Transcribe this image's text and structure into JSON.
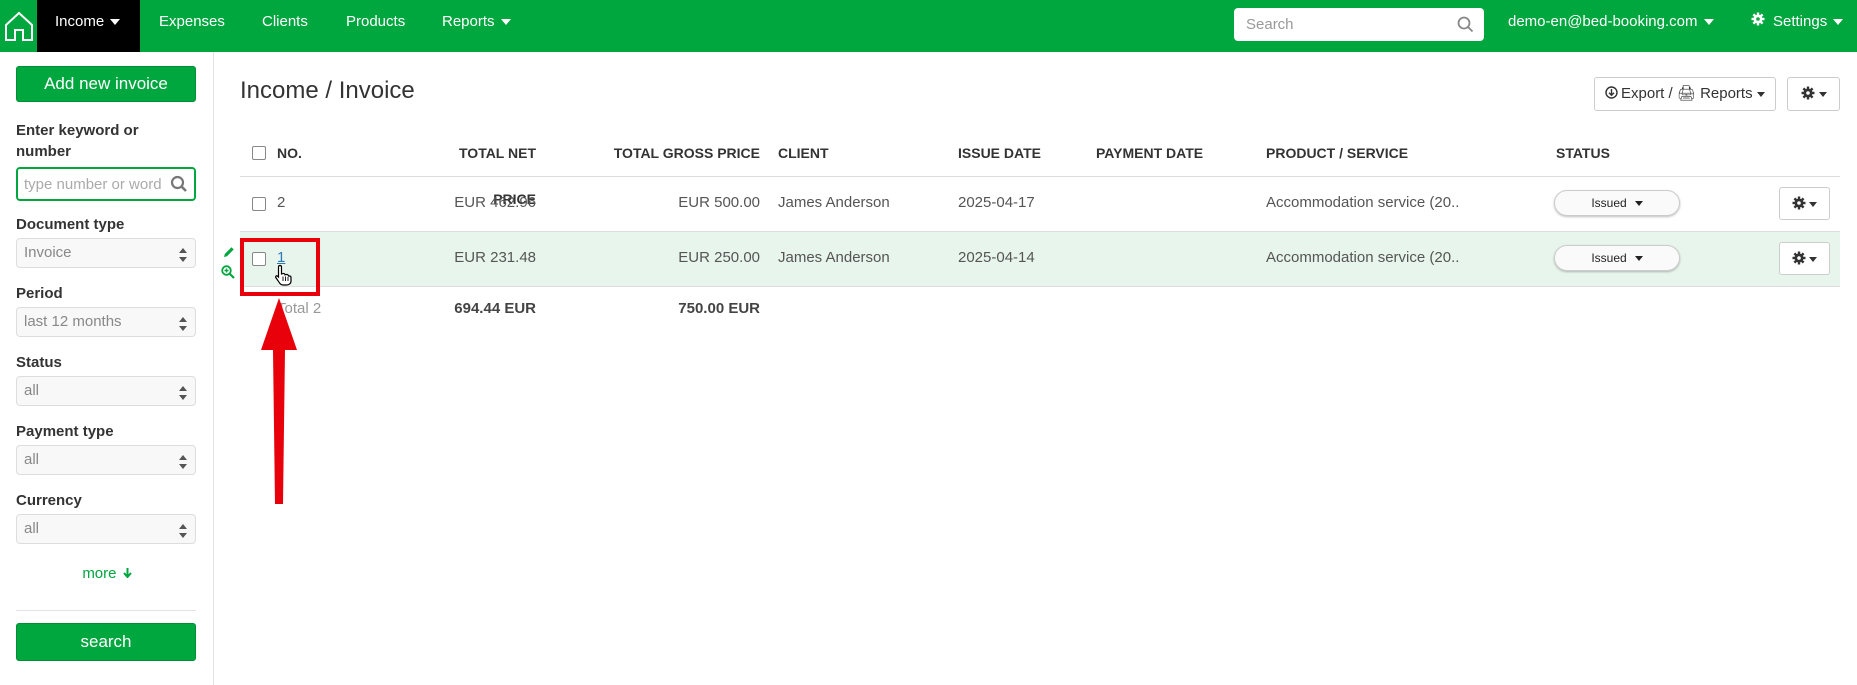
{
  "nav": {
    "items": [
      "Income",
      "Expenses",
      "Clients",
      "Products",
      "Reports"
    ],
    "search_placeholder": "Search",
    "user_email": "demo-en@bed-booking.com",
    "settings_label": "Settings"
  },
  "sidebar": {
    "add_button": "Add new invoice",
    "keyword_label": "Enter keyword or number",
    "keyword_placeholder": "type number or word",
    "document_type_label": "Document type",
    "document_type_value": "Invoice",
    "period_label": "Period",
    "period_value": "last 12 months",
    "status_label": "Status",
    "status_value": "all",
    "payment_type_label": "Payment type",
    "payment_type_value": "all",
    "currency_label": "Currency",
    "currency_value": "all",
    "more_link": "more",
    "search_button": "search"
  },
  "main": {
    "title": "Income / Invoice",
    "export_button": "Export / 🖨 Reports"
  },
  "table": {
    "headers": [
      "NO.",
      "TOTAL NET PRICE",
      "TOTAL GROSS PRICE",
      "CLIENT",
      "ISSUE DATE",
      "PAYMENT DATE",
      "PRODUCT / SERVICE",
      "STATUS"
    ],
    "rows": [
      {
        "no": "2",
        "net": "EUR 462.96",
        "gross": "EUR 500.00",
        "client": "James Anderson",
        "issue_date": "2025-04-17",
        "payment_date": "",
        "product": "Accommodation service (20..",
        "status": "Issued"
      },
      {
        "no": "1",
        "net": "EUR 231.48",
        "gross": "EUR 250.00",
        "client": "James Anderson",
        "issue_date": "2025-04-14",
        "payment_date": "",
        "product": "Accommodation service (20..",
        "status": "Issued"
      }
    ],
    "totals": {
      "label": "Total 2",
      "net": "694.44 EUR",
      "gross": "750.00 EUR"
    }
  },
  "colors": {
    "brand": "#00a63e",
    "highlight_row": "#e8f5ec",
    "annotation": "#e8000b"
  }
}
